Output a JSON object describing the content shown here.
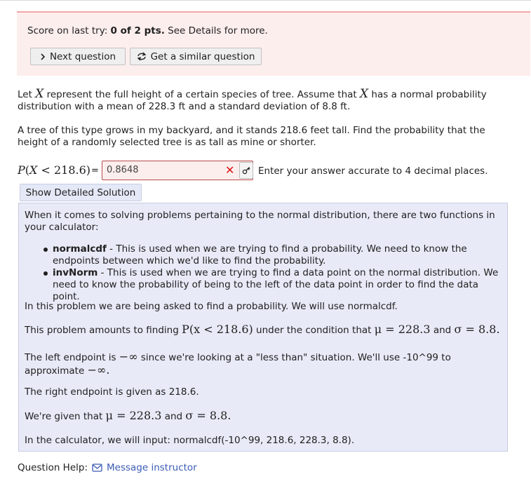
{
  "score": {
    "prefix": "Score on last try:",
    "value": "0 of 2 pts.",
    "suffix": "See Details for more."
  },
  "buttons": {
    "next": "Next question",
    "similar": "Get a similar question",
    "show_solution": "Show Detailed Solution"
  },
  "question": {
    "p1_a": "Let",
    "var_x": "X",
    "p1_b": "represent the full height of a certain species of tree. Assume that",
    "p1_c": "has a normal probability distribution with a mean of 228.3 ft and a standard deviation of 8.8 ft.",
    "p2": "A tree of this type grows in my backyard, and it stands 218.6 feet tall. Find the probability that the height of a randomly selected tree is as tall as mine or shorter."
  },
  "answer": {
    "label_p": "P",
    "label_x": "X",
    "label_rest": "< 218.6)",
    "equals": "=",
    "value": "0.8648",
    "hint": "Enter your answer accurate to 4 decimal places."
  },
  "solution": {
    "intro": "When it comes to solving problems pertaining to the normal distribution, there are two functions in your calculator:",
    "bullet1_term": "normalcdf",
    "bullet1_text": " - This is used when we are trying to find a probability. We need to know the endpoints between which we'd like to find the probability.",
    "bullet2_term": "invNorm",
    "bullet2_text": " - This is used when we are trying to find a data point on the normal distribution. We need to know the probability of being to the left of the data point in order to find the data point.",
    "line1": "In this problem we are being asked to find a probability. We will use normalcdf.",
    "line2_a": "This problem amounts to finding",
    "line2_math": "P(x < 218.6)",
    "line2_b": "under the condition that",
    "line2_mu": "μ = 228.3",
    "line2_and": "and",
    "line2_sigma": "σ = 8.8.",
    "line3_a": "The left endpoint is",
    "line3_inf": "−∞",
    "line3_b": "since we're looking at a \"less than\" situation. We'll use -10^99 to approximate",
    "line3_inf2": "−∞.",
    "line4": "The right endpoint is given as 218.6.",
    "line5_a": "We're given that",
    "line5_mu": "μ = 228.3",
    "line5_and": "and",
    "line5_sigma": "σ = 8.8.",
    "line6": "In the calculator, we will input: normalcdf(-10^99, 218.6, 228.3, 8.8)."
  },
  "help": {
    "label": "Question Help:",
    "link": "Message instructor"
  },
  "icons": {
    "next": "chevron-right-icon",
    "similar": "refresh-icon",
    "clear": "close-icon",
    "key": "key-icon",
    "mail": "mail-icon"
  },
  "colors": {
    "score_bg": "#fdeeee",
    "solution_bg": "#e8eaf7",
    "link": "#3b5bb5",
    "error": "#dd1111"
  }
}
